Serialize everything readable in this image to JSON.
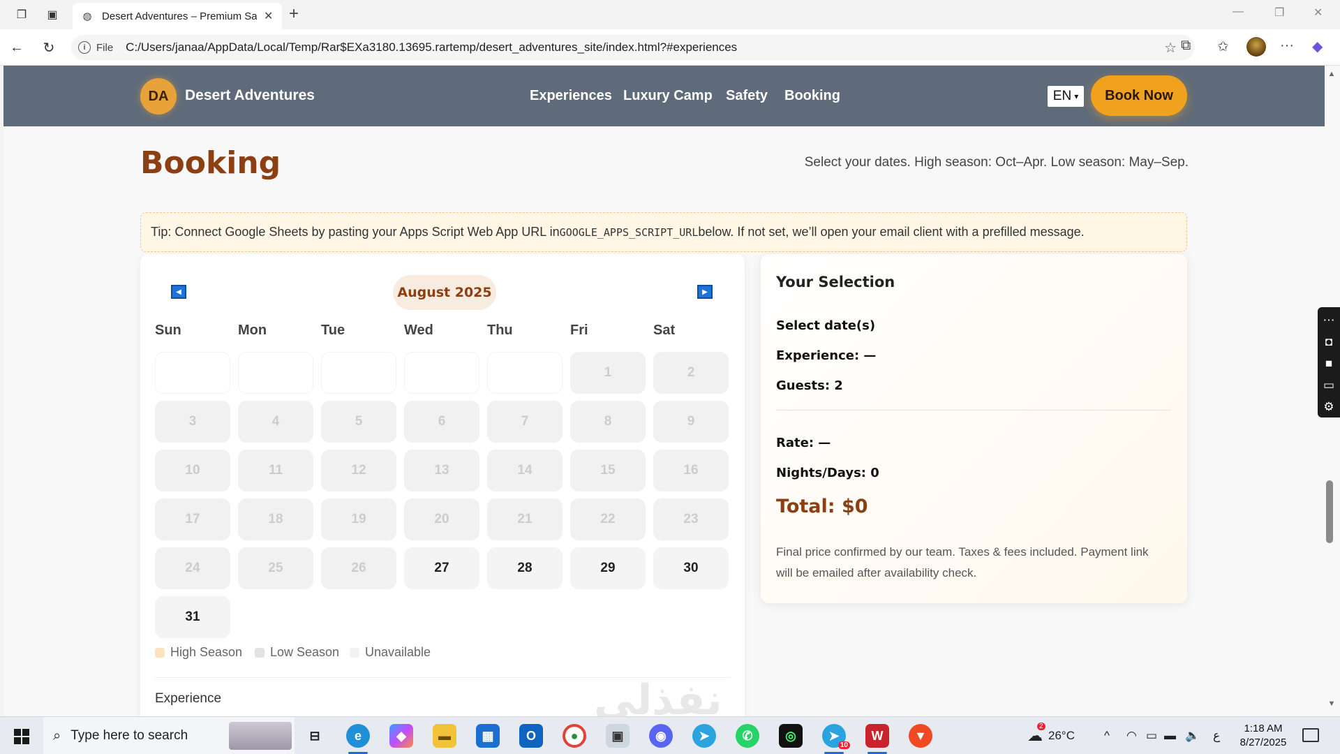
{
  "browser": {
    "tab_title": "Desert Adventures – Premium Saf",
    "url_scheme": "File",
    "url": "C:/Users/janaa/AppData/Local/Temp/Rar$EXa3180.13695.rartemp/desert_adventures_site/index.html?#experiences"
  },
  "site": {
    "logo_initials": "DA",
    "logo_text": "Desert Adventures",
    "nav": [
      "Experiences",
      "Luxury Camp",
      "Safety",
      "Booking"
    ],
    "language": "EN",
    "book_now": "Book Now"
  },
  "booking": {
    "title": "Booking",
    "subtitle": "Select your dates. High season: Oct–Apr. Low season: May–Sep.",
    "tip_before": "Tip: Connect Google Sheets by pasting your Apps Script Web App URL in ",
    "tip_code": "GOOGLE_APPS_SCRIPT_URL",
    "tip_after": " below. If not set, we’ll open your email client with a prefilled message.",
    "calendar": {
      "month_label": "August 2025",
      "weekdays": [
        "Sun",
        "Mon",
        "Tue",
        "Wed",
        "Thu",
        "Fri",
        "Sat"
      ],
      "first_weekday_index": 5,
      "days_in_month": 31,
      "first_available_day": 27,
      "legend": [
        "High Season",
        "Low Season",
        "Unavailable"
      ],
      "legend_colors": [
        "#fbe3bf",
        "#e3e3e3",
        "#f2f2f2"
      ]
    },
    "experience_label": "Experience",
    "watermark": "نفذلي"
  },
  "selection": {
    "title": "Your Selection",
    "dates": "Select date(s)",
    "experience": "Experience: —",
    "guests": "Guests: 2",
    "rate": "Rate: —",
    "nights": "Nights/Days: 0",
    "total": "Total: $0",
    "note": "Final price confirmed by our team. Taxes & fees included. Payment link will be emailed after availability check."
  },
  "taskbar": {
    "search_placeholder": "Type here to search",
    "weather_temp": "26°C",
    "weather_badge": "2",
    "lang_indicator": "ع",
    "time": "1:18 AM",
    "date": "8/27/2025",
    "telegram_badge": "10"
  }
}
